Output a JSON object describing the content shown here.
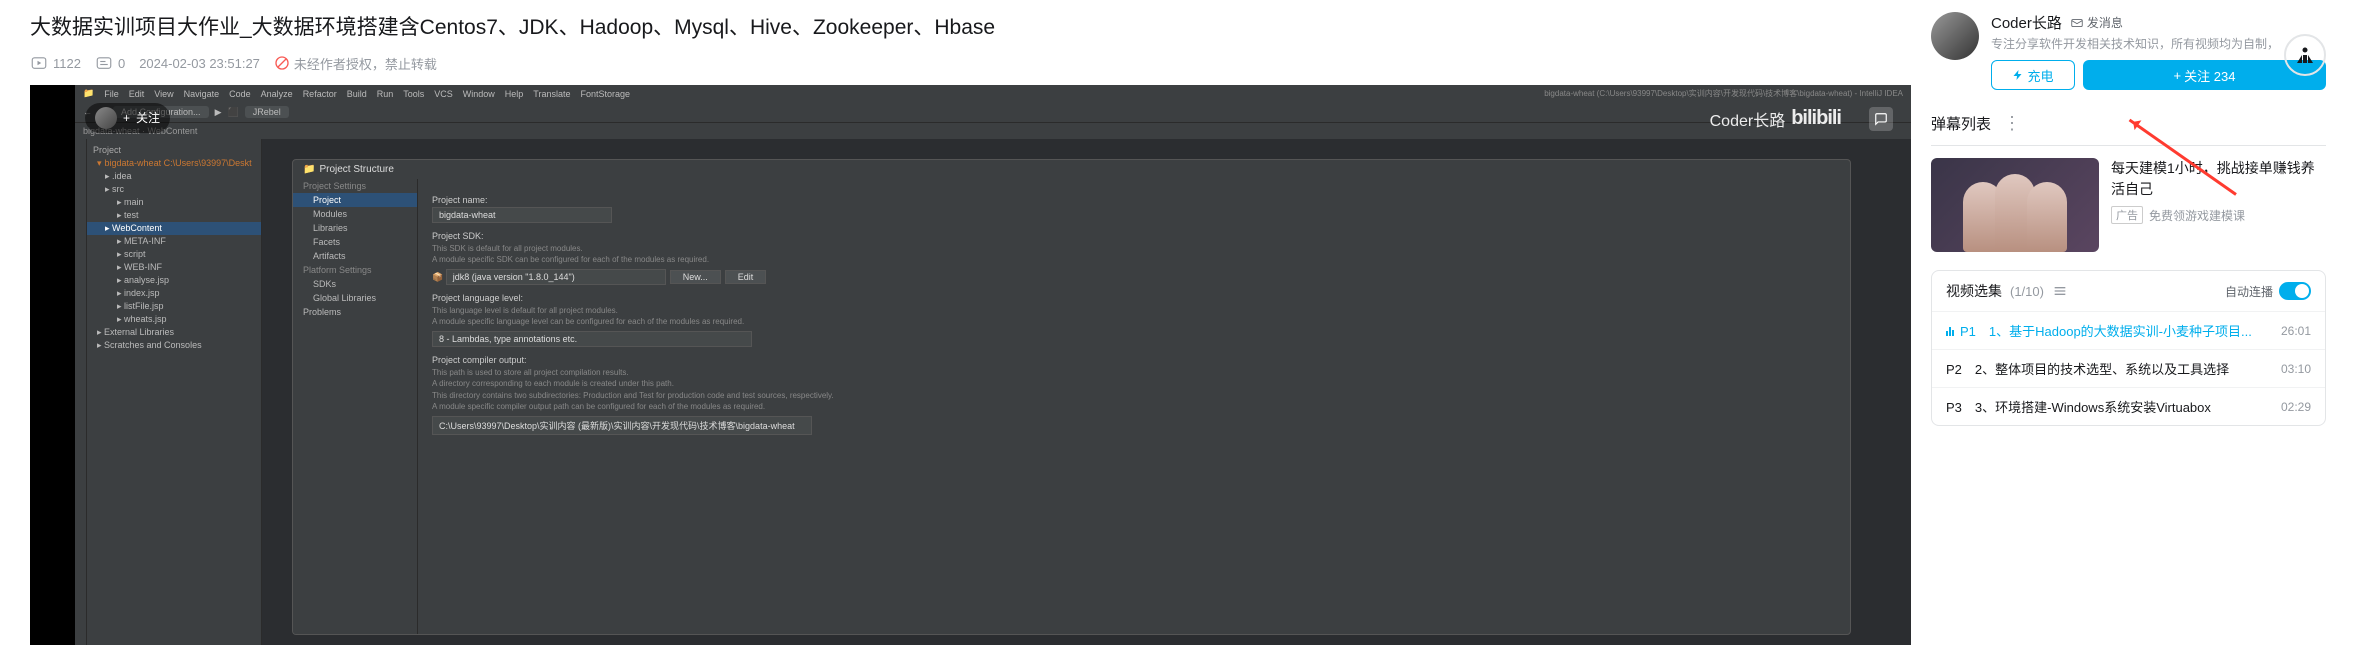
{
  "title": "大数据实训项目大作业_大数据环境搭建含Centos7、JDK、Hadoop、Mysql、Hive、Zookeeper、Hbase",
  "meta": {
    "views": "1122",
    "danmaku": "0",
    "date": "2024-02-03 23:51:27",
    "no_repost": "未经作者授权，禁止转载"
  },
  "player": {
    "follow_label": "关注",
    "watermark": "Coder长路",
    "feedback_icon": "?",
    "ide": {
      "menu": [
        "File",
        "Edit",
        "View",
        "Navigate",
        "Code",
        "Analyze",
        "Refactor",
        "Build",
        "Run",
        "Tools",
        "VCS",
        "Window",
        "Help",
        "Translate",
        "FontStorage"
      ],
      "window_title": "bigdata-wheat (C:\\Users\\93997\\Desktop\\实训内容\\开发现代码\\技术博客\\bigdata-wheat) - IntelliJ IDEA",
      "toolbar": {
        "config": "Add Configuration...",
        "jrebel": "JRebel"
      },
      "tabs": "bigdata-wheat · WebContent",
      "tree": {
        "header": "Project",
        "root": "bigdata-wheat C:\\Users\\93997\\Deskt",
        "items": [
          {
            "l": "l1",
            "t": ".idea"
          },
          {
            "l": "l1",
            "t": "src"
          },
          {
            "l": "l2",
            "t": "main"
          },
          {
            "l": "l2",
            "t": "test"
          },
          {
            "l": "l1",
            "t": "WebContent",
            "sel": true
          },
          {
            "l": "l2",
            "t": "META-INF"
          },
          {
            "l": "l2",
            "t": "script"
          },
          {
            "l": "l2",
            "t": "WEB-INF"
          },
          {
            "l": "l2",
            "t": "analyse.jsp"
          },
          {
            "l": "l2",
            "t": "index.jsp"
          },
          {
            "l": "l2",
            "t": "listFile.jsp"
          },
          {
            "l": "l2",
            "t": "wheats.jsp"
          },
          {
            "l": "",
            "t": "External Libraries"
          },
          {
            "l": "",
            "t": "Scratches and Consoles"
          }
        ]
      },
      "dialog": {
        "title": "Project Structure",
        "nav": [
          {
            "t": "Project Settings",
            "g": true
          },
          {
            "t": "Project",
            "sel": true,
            "sub": true
          },
          {
            "t": "Modules",
            "sub": true
          },
          {
            "t": "Libraries",
            "sub": true
          },
          {
            "t": "Facets",
            "sub": true
          },
          {
            "t": "Artifacts",
            "sub": true
          },
          {
            "t": "Platform Settings",
            "g": true
          },
          {
            "t": "SDKs",
            "sub": true
          },
          {
            "t": "Global Libraries",
            "sub": true
          },
          {
            "t": "Problems"
          }
        ],
        "name_label": "Project name:",
        "name_value": "bigdata-wheat",
        "sdk_label": "Project SDK:",
        "sdk_desc1": "This SDK is default for all project modules.",
        "sdk_desc2": "A module specific SDK can be configured for each of the modules as required.",
        "sdk_value": "jdk8 (java version \"1.8.0_144\")",
        "btn_new": "New...",
        "btn_edit": "Edit",
        "lang_label": "Project language level:",
        "lang_desc1": "This language level is default for all project modules.",
        "lang_desc2": "A module specific language level can be configured for each of the modules as required.",
        "lang_value": "8 - Lambdas, type annotations etc.",
        "out_label": "Project compiler output:",
        "out_desc1": "This path is used to store all project compilation results.",
        "out_desc2": "A directory corresponding to each module is created under this path.",
        "out_desc3": "This directory contains two subdirectories: Production and Test for production code and test sources, respectively.",
        "out_desc4": "A module specific compiler output path can be configured for each of the modules as required.",
        "out_value": "C:\\Users\\93997\\Desktop\\实训内容 (最新版)\\实训内容\\开发现代码\\技术博客\\bigdata-wheat"
      }
    }
  },
  "uploader": {
    "name": "Coder长路",
    "msg": "发消息",
    "desc": "专注分享软件开发相关技术知识，所有视频均为自制，",
    "charge": "充电",
    "follow": "关注 234"
  },
  "danmaku_bar": {
    "label": "弹幕列表"
  },
  "ad": {
    "title": "每天建模1小时，挑战接单赚钱养活自己",
    "badge": "广告",
    "sub": "免费领游戏建模课"
  },
  "playlist": {
    "title": "视频选集",
    "count": "(1/10)",
    "auto": "自动连播",
    "items": [
      {
        "p": "P1",
        "t": "1、基于Hadoop的大数据实训-小麦种子项目...",
        "d": "26:01",
        "active": true
      },
      {
        "p": "P2",
        "t": "2、整体项目的技术选型、系统以及工具选择",
        "d": "03:10"
      },
      {
        "p": "P3",
        "t": "3、环境搭建-Windows系统安装Virtuabox",
        "d": "02:29"
      }
    ]
  }
}
